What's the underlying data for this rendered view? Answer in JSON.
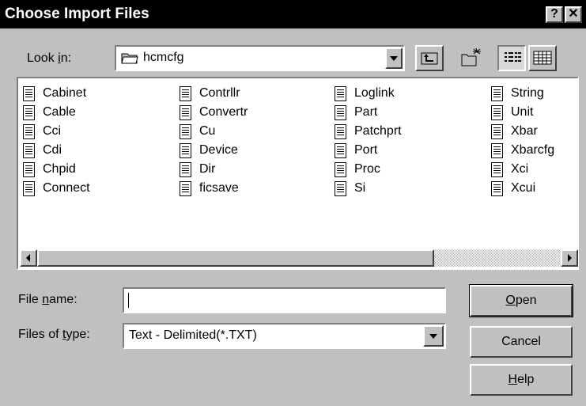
{
  "window": {
    "title": "Choose Import Files",
    "help_btn": "?",
    "close_btn": "✕"
  },
  "lookin": {
    "label_pre": "Look ",
    "label_u": "i",
    "label_post": "n:",
    "value": "hcmcfg"
  },
  "files": [
    "Cabinet",
    "Cable",
    "Cci",
    "Cdi",
    "Chpid",
    "Connect",
    "Contrllr",
    "Convertr",
    "Cu",
    "Device",
    "Dir",
    "ficsave",
    "Loglink",
    "Part",
    "Patchprt",
    "Port",
    "Proc",
    "Si",
    "String",
    "Unit",
    "Xbar",
    "Xbarcfg",
    "Xci",
    "Xcui"
  ],
  "filename": {
    "label_pre": "File ",
    "label_u": "n",
    "label_post": "ame:",
    "value": ""
  },
  "filetype": {
    "label_pre": "Files of ",
    "label_u": "t",
    "label_post": "ype:",
    "value": "Text - Delimited(*.TXT)"
  },
  "buttons": {
    "open_u": "O",
    "open_rest": "pen",
    "cancel": "Cancel",
    "help_u": "H",
    "help_rest": "elp"
  }
}
